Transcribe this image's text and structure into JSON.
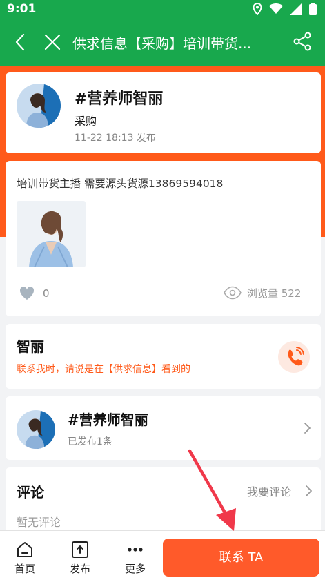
{
  "status_bar": {
    "time": "9:01"
  },
  "nav": {
    "title": "供求信息【采购】培训带货..."
  },
  "author": {
    "name": "#营养师智丽",
    "type": "采购",
    "time": "11-22 18:13 发布"
  },
  "content": {
    "text": "培训带货主播 需要源头货源13869594018",
    "likes": "0",
    "views": "浏览量 522"
  },
  "contact": {
    "name": "智丽",
    "note": "联系我时，请说是在【供求信息】看到的"
  },
  "publisher": {
    "name": "#营养师智丽",
    "count": "已发布1条"
  },
  "comments": {
    "title": "评论",
    "action": "我要评论",
    "empty": "暂无评论"
  },
  "bottom": {
    "home": "首页",
    "publish": "发布",
    "more": "更多",
    "contact": "联系 TA"
  },
  "colors": {
    "nav_green": "#18a84d",
    "accent_orange": "#ff5a1a"
  }
}
